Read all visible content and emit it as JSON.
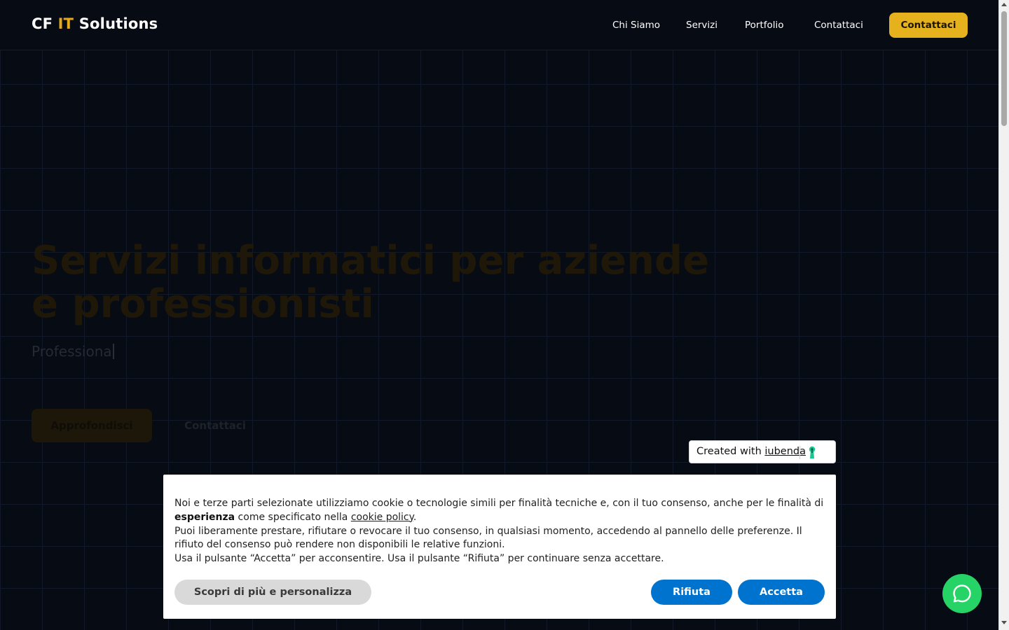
{
  "header": {
    "logo_part1": "CF ",
    "logo_accent": "IT",
    "logo_part2": " Solutions",
    "nav": [
      {
        "label": "Chi Siamo"
      },
      {
        "label": "Servizi"
      },
      {
        "label": "Portfolio"
      },
      {
        "label": "Contattaci"
      }
    ],
    "cta_label": "Contattaci"
  },
  "hero": {
    "title": "Servizi informatici per aziende e professionisti",
    "subtitle_typing": "Professiona",
    "primary_button": "Approfondisci",
    "secondary_button": "Contattaci"
  },
  "iubenda_badge": {
    "prefix": "Created with ",
    "link": "iubenda",
    "icon": "keyhole-icon"
  },
  "cookie_banner": {
    "line1_a": "Noi e terze parti selezionate utilizziamo cookie o tecnologie simili per finalità tecniche e, con il tuo consenso, anche per le finalità di ",
    "line1_bold": "esperienza",
    "line1_b": " come specificato nella ",
    "line1_link": "cookie policy",
    "line1_c": ".",
    "line2": "Puoi liberamente prestare, rifiutare o revocare il tuo consenso, in qualsiasi momento, accedendo al pannello delle preferenze. Il rifiuto del consenso può rendere non disponibili le relative funzioni.",
    "line3": "Usa il pulsante “Accetta” per acconsentire. Usa il pulsante “Rifiuta” per continuare senza accettare.",
    "btn_more": "Scopri di più e personalizza",
    "btn_reject": "Rifiuta",
    "btn_accept": "Accetta"
  },
  "whatsapp": {
    "icon": "whatsapp-icon"
  },
  "colors": {
    "background": "#070b13",
    "accent": "#e5b21e",
    "cookie_button": "#0073ce",
    "whatsapp": "#25d366"
  }
}
